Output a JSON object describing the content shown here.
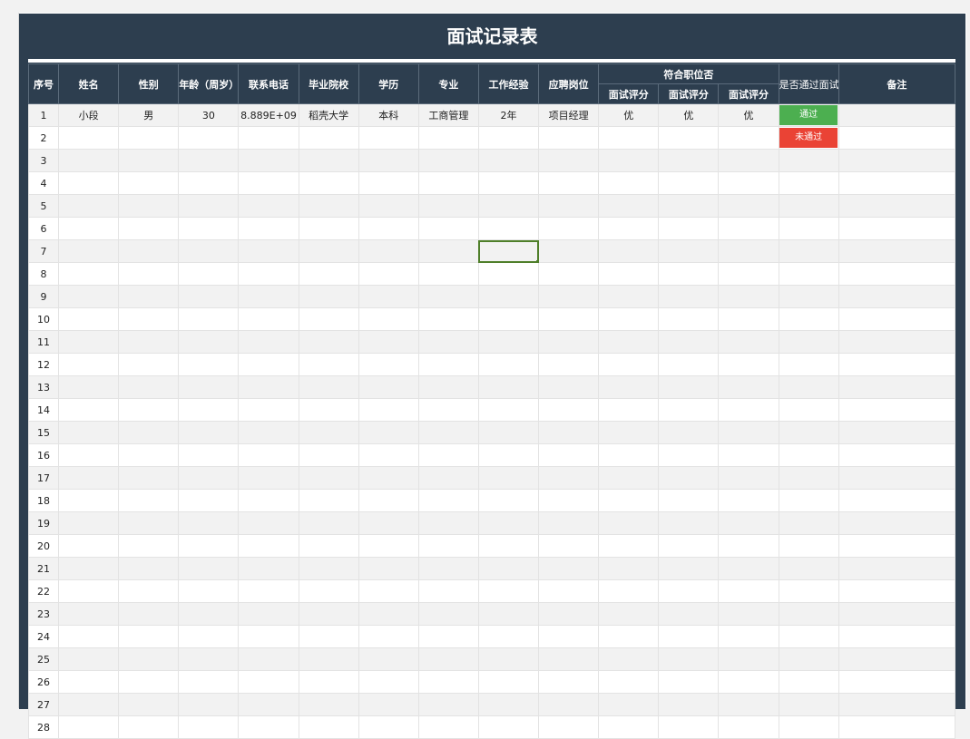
{
  "title": "面试记录表",
  "headers": {
    "seq": "序号",
    "name": "姓名",
    "gender": "性别",
    "age": "年龄（周岁）",
    "phone": "联系电话",
    "school": "毕业院校",
    "education": "学历",
    "major": "专业",
    "experience": "工作经验",
    "position": "应聘岗位",
    "fit_group": "符合职位否",
    "score1": "面试评分",
    "score2": "面试评分",
    "score3": "面试评分",
    "passed": "是否通过面试",
    "remark": "备注"
  },
  "rows": [
    {
      "seq": "1",
      "name": "小段",
      "gender": "男",
      "age": "30",
      "phone": "8.889E+09",
      "school": "稻壳大学",
      "education": "本科",
      "major": "工商管理",
      "experience": "2年",
      "position": "项目经理",
      "score1": "优",
      "score2": "优",
      "score3": "优",
      "passed": "通过",
      "remark": ""
    },
    {
      "seq": "2",
      "passed": "未通过"
    },
    {
      "seq": "3"
    },
    {
      "seq": "4"
    },
    {
      "seq": "5"
    },
    {
      "seq": "6"
    },
    {
      "seq": "7"
    },
    {
      "seq": "8"
    },
    {
      "seq": "9"
    },
    {
      "seq": "10"
    },
    {
      "seq": "11"
    },
    {
      "seq": "12"
    },
    {
      "seq": "13"
    },
    {
      "seq": "14"
    },
    {
      "seq": "15"
    },
    {
      "seq": "16"
    },
    {
      "seq": "17"
    },
    {
      "seq": "18"
    },
    {
      "seq": "19"
    },
    {
      "seq": "20"
    },
    {
      "seq": "21"
    },
    {
      "seq": "22"
    },
    {
      "seq": "23"
    },
    {
      "seq": "24"
    },
    {
      "seq": "25"
    },
    {
      "seq": "26"
    },
    {
      "seq": "27"
    },
    {
      "seq": "28"
    }
  ],
  "colors": {
    "header_bg": "#2d3e4f",
    "pass": "#4caf50",
    "fail": "#ea4335",
    "selection": "#4f7f2a"
  },
  "selected_cell": {
    "row": 7,
    "column": "experience"
  }
}
